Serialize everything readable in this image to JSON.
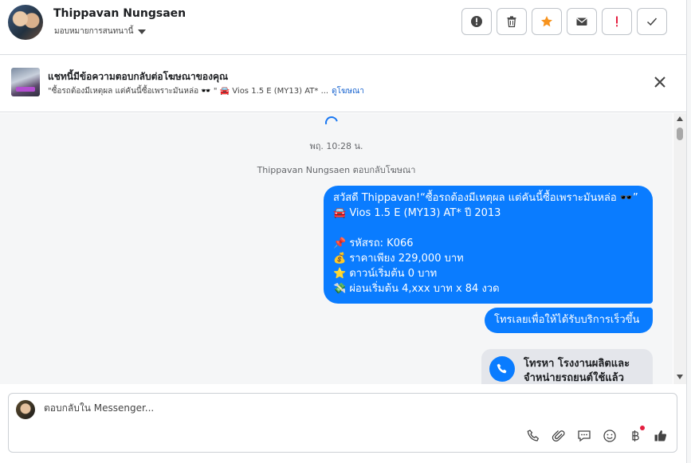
{
  "header": {
    "contact_name": "Thippavan Nungsaen",
    "assign_label": "มอบหมายการสนทนานี้",
    "actions": [
      {
        "name": "report-button",
        "icon": "alert-circle-icon"
      },
      {
        "name": "delete-button",
        "icon": "trash-icon"
      },
      {
        "name": "star-button",
        "icon": "star-icon",
        "color": "#f7931e"
      },
      {
        "name": "mark-unread-button",
        "icon": "envelope-icon"
      },
      {
        "name": "spam-button",
        "icon": "exclamation-icon",
        "color": "#e41e3f"
      },
      {
        "name": "mark-done-button",
        "icon": "checkmark-icon"
      }
    ]
  },
  "banner": {
    "title": "แชทนี้มีข้อความตอบกลับต่อโฆษณาของคุณ",
    "subtitle": "\"ซื้อรถต้องมีเหตุผล แต่คันนี้ซื้อเพราะมันหล่อ 🕶️ \" 🚘 Vios 1.5 E (MY13) AT* ...",
    "link": "ดูโฆษณา"
  },
  "chat": {
    "timestamp": "พฤ. 10:28 น.",
    "replied_note": "Thippavan Nungsaen ตอบกลับโฆษณา",
    "main_message_lines": [
      "สวัสดี Thippavan!“ซื้อรถต้องมีเหตุผล แต่คันนี้ซื้อเพราะมันหล่อ 🕶️”",
      "🚘 Vios 1.5 E (MY13) AT* ปี 2013",
      "",
      "📌 รหัสรถ: K066",
      "💰 ราคาเพียง 229,000 บาท",
      "⭐ ดาวน์เริ่มต้น 0 บาท",
      "💸 ผ่อนเริ่มต้น 4,xxx บาท x 84 งวด"
    ],
    "cta_message": "โทรเลยเพื่อให้ได้รับบริการเร็วขึ้น",
    "call_card_text": "โทรหา โรงงานผลิตและจำหน่ายรถยนต์ใช้แล้ว"
  },
  "composer": {
    "placeholder": "ตอบกลับใน Messenger...",
    "tools": [
      "phone-icon",
      "paperclip-icon",
      "chat-bubble-icon",
      "smiley-icon",
      "baht-icon",
      "thumbs-up-icon"
    ]
  },
  "colors": {
    "accent": "#0a7cff",
    "bubble_text": "#ffffff",
    "star": "#f7931e",
    "danger": "#e41e3f"
  }
}
